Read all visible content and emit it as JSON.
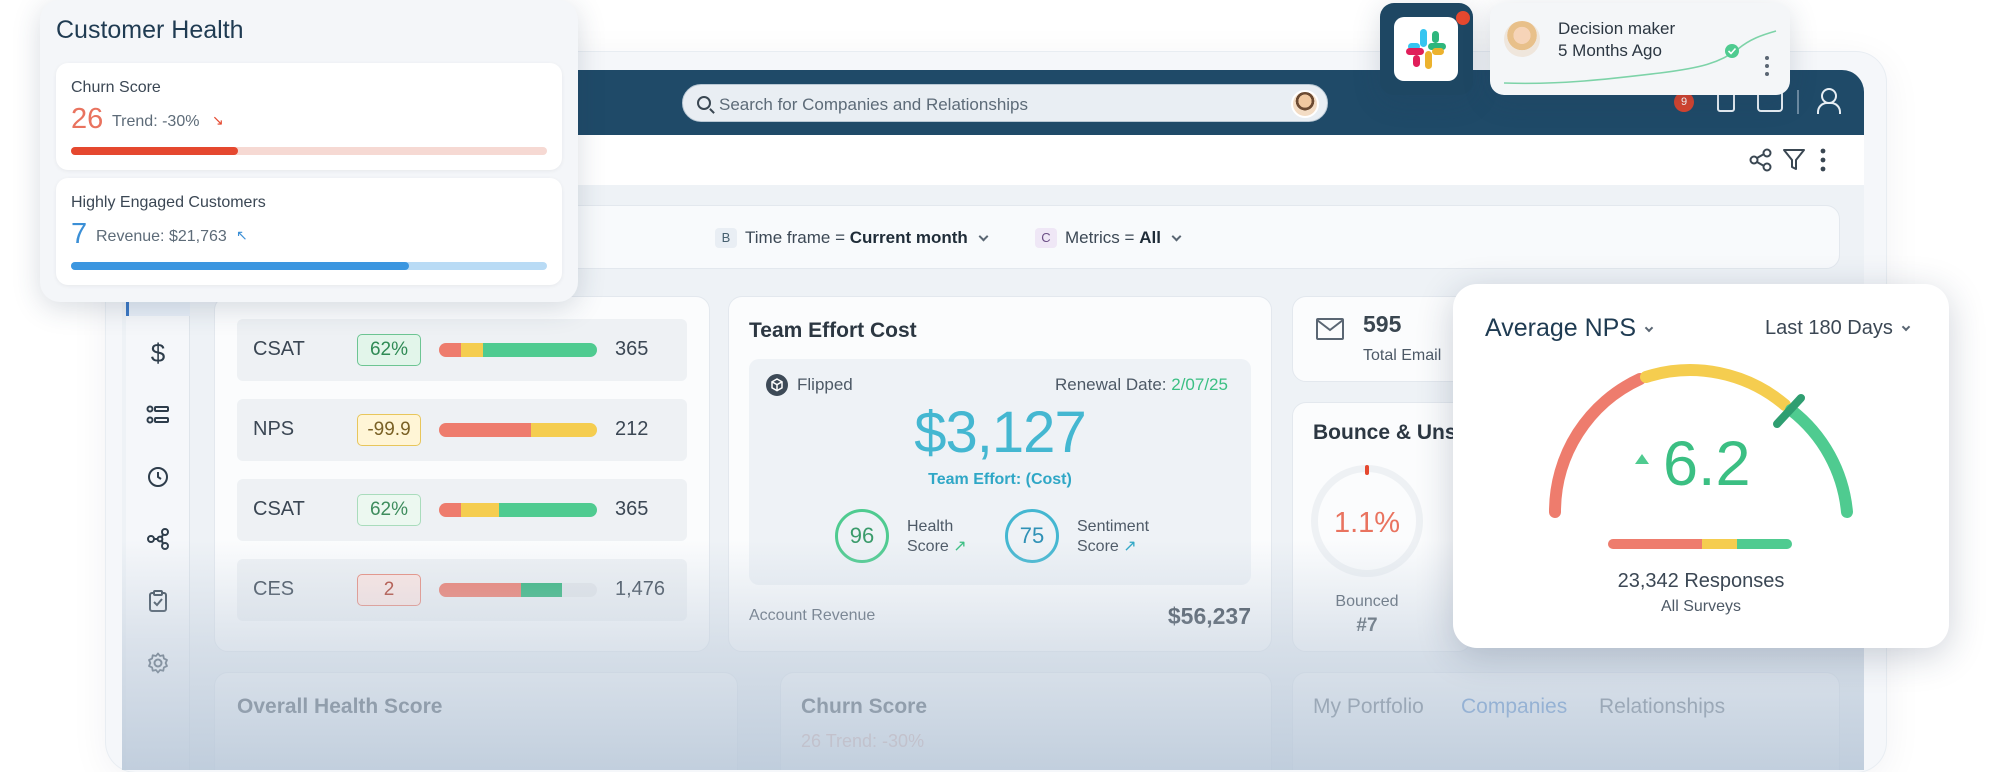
{
  "search": {
    "placeholder": "Search for Companies and Relationships"
  },
  "topbar": {
    "notification_count": "9"
  },
  "filters": [
    {
      "key": "B",
      "label": "Time frame",
      "op": "=",
      "value": "Current month"
    },
    {
      "key": "C",
      "label": "Metrics",
      "op": "=",
      "value": "All"
    }
  ],
  "metrics": [
    {
      "name": "CSAT",
      "badge": "62%",
      "count": "365",
      "segments": [
        {
          "pct": 14,
          "color": "#ee7c6d"
        },
        {
          "pct": 14,
          "color": "#f5cd4f"
        },
        {
          "pct": 72,
          "color": "#4fcb90"
        }
      ]
    },
    {
      "name": "NPS",
      "badge": "-99.9",
      "count": "212",
      "segments": [
        {
          "pct": 58,
          "color": "#ee7c6d"
        },
        {
          "pct": 42,
          "color": "#f5cd4f"
        }
      ]
    },
    {
      "name": "CSAT",
      "badge": "62%",
      "count": "365",
      "segments": [
        {
          "pct": 14,
          "color": "#ee7c6d"
        },
        {
          "pct": 24,
          "color": "#f5cd4f"
        },
        {
          "pct": 62,
          "color": "#4fcb90"
        }
      ]
    },
    {
      "name": "CES",
      "badge": "2",
      "count": "1,476",
      "segments": [
        {
          "pct": 52,
          "color": "#ee7c6d"
        },
        {
          "pct": 26,
          "color": "#2fb47a"
        }
      ]
    }
  ],
  "team_effort": {
    "title": "Team Effort Cost",
    "tag": "Flipped",
    "renewal_label": "Renewal Date:",
    "renewal_date": "2/07/25",
    "amount": "$3,127",
    "amount_label": "Team Effort: (Cost)",
    "health_score": "96",
    "health_label_1": "Health",
    "health_label_2": "Score",
    "sentiment_score": "75",
    "sentiment_label_1": "Sentiment",
    "sentiment_label_2": "Score",
    "revenue_label": "Account Revenue",
    "revenue_value": "$56,237"
  },
  "email": {
    "count": "595",
    "label": "Total Email"
  },
  "bounce": {
    "title": "Bounce & Uns",
    "pct": "1.1%",
    "label": "Bounced",
    "rank": "#7"
  },
  "bottom": {
    "overall_title": "Overall Health Score",
    "churn_title": "Churn Score",
    "churn_faded": "26 Trend: -30%",
    "tabs": [
      "My Portfolio",
      "Companies",
      "Relationships"
    ]
  },
  "customer_health": {
    "title": "Customer Health",
    "churn": {
      "label": "Churn Score",
      "value": "26",
      "trend": "Trend: -30%",
      "progress": 0.35
    },
    "engaged": {
      "label": "Highly Engaged Customers",
      "value": "7",
      "revenue": "Revenue: $21,763",
      "progress": 0.71
    }
  },
  "decision_maker": {
    "role": "Decision maker",
    "when": "5 Months Ago"
  },
  "nps": {
    "title": "Average NPS",
    "range": "Last 180 Days",
    "value": "6.2",
    "responses": "23,342 Responses",
    "surveys": "All Surveys",
    "gauge_fraction": 0.62
  },
  "colors": {
    "accent": "#3b78c4",
    "danger": "#e5482f",
    "good": "#4fcb90",
    "warn": "#f5cd4f",
    "bad": "#ee7c6d",
    "teal": "#44b7d1"
  }
}
